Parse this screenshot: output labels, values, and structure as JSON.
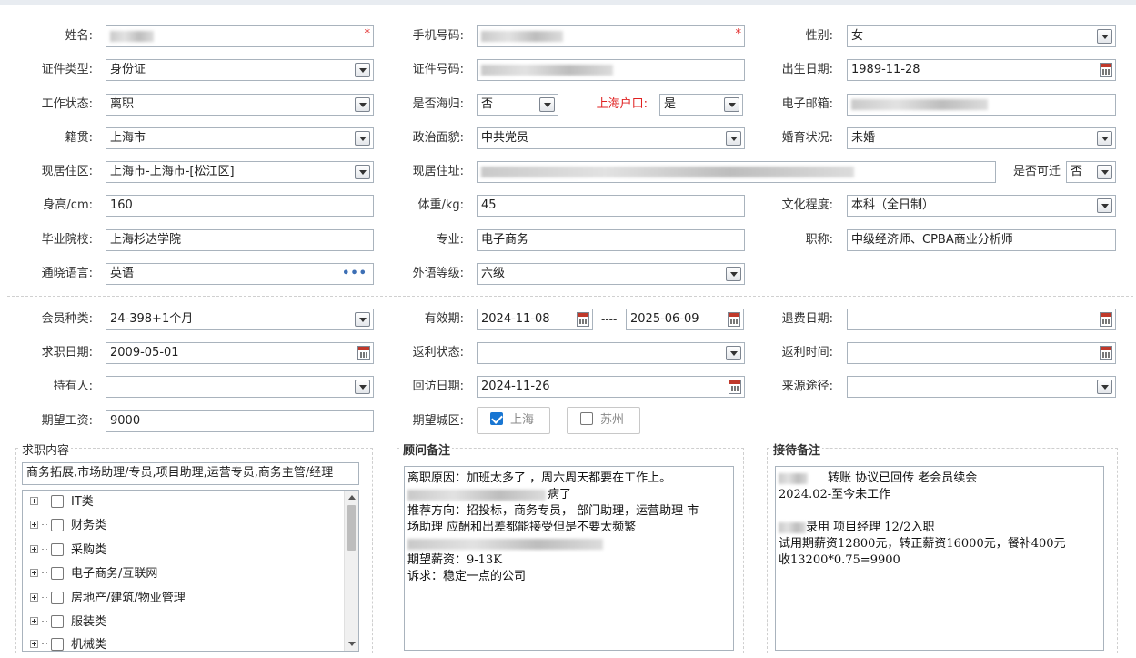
{
  "personal": {
    "name_label": "姓名:",
    "phone_label": "手机号码:",
    "gender_label": "性别:",
    "gender_value": "女",
    "id_type_label": "证件类型:",
    "id_type_value": "身份证",
    "id_number_label": "证件号码:",
    "birth_label": "出生日期:",
    "birth_value": "1989-11-28",
    "work_status_label": "工作状态:",
    "work_status_value": "离职",
    "overseas_label": "是否海归:",
    "overseas_value": "否",
    "hukou_label": "上海户口:",
    "hukou_value": "是",
    "email_label": "电子邮箱:",
    "native_label": "籍贯:",
    "native_value": "上海市",
    "political_label": "政治面貌:",
    "political_value": "中共党员",
    "marital_label": "婚育状况:",
    "marital_value": "未婚",
    "residence_area_label": "现居住区:",
    "residence_area_value": "上海市-上海市-[松江区]",
    "residence_addr_label": "现居住址:",
    "relocate_label": "是否可迁",
    "relocate_value": "否",
    "height_label": "身高/cm:",
    "height_value": "160",
    "weight_label": "体重/kg:",
    "weight_value": "45",
    "education_label": "文化程度:",
    "education_value": "本科（全日制）",
    "school_label": "毕业院校:",
    "school_value": "上海杉达学院",
    "major_label": "专业:",
    "major_value": "电子商务",
    "title_label": "职称:",
    "title_value": "中级经济师、CPBA商业分析师",
    "language_label": "通晓语言:",
    "language_value": "英语",
    "lang_level_label": "外语等级:",
    "lang_level_value": "六级"
  },
  "membership": {
    "type_label": "会员种类:",
    "type_value": "24-398+1个月",
    "validity_label": "有效期:",
    "valid_from": "2024-11-08",
    "valid_sep": "----",
    "valid_to": "2025-06-09",
    "refund_date_label": "退费日期:",
    "job_date_label": "求职日期:",
    "job_date_value": "2009-05-01",
    "rebate_status_label": "返利状态:",
    "rebate_time_label": "返利时间:",
    "holder_label": "持有人:",
    "visit_date_label": "回访日期:",
    "visit_date_value": "2024-11-26",
    "source_label": "来源途径:",
    "salary_label": "期望工资:",
    "salary_value": "9000",
    "city_label": "期望城区:",
    "cities": [
      {
        "label": "上海",
        "checked": true
      },
      {
        "label": "苏州",
        "checked": false
      }
    ]
  },
  "job_content": {
    "title": "求职内容",
    "summary": "商务拓展,市场助理/专员,项目助理,运营专员,商务主管/经理",
    "tree": [
      "IT类",
      "财务类",
      "采购类",
      "电子商务/互联网",
      "房地产/建筑/物业管理",
      "服装类",
      "机械类"
    ]
  },
  "consultant_notes": {
    "title": "顾问备注",
    "lines": [
      "离职原因：加班太多了 ，周六周天都要在工作上。",
      "病了",
      "推荐方向：招投标，商务专员， 部门助理，运营助理 市",
      "场助理    应酬和出差都能接受但是不要太频繁",
      "",
      "期望薪资：9-13K",
      "诉求：稳定一点的公司"
    ]
  },
  "reception_notes": {
    "title": "接待备注",
    "lines": [
      "转账    协议已回传  老会员续会",
      "2024.02-至今未工作",
      "",
      "录用 项目经理 12/2入职",
      "试用期薪资12800元，转正薪资16000元，餐补400元",
      "收13200*0.75=9900"
    ]
  }
}
